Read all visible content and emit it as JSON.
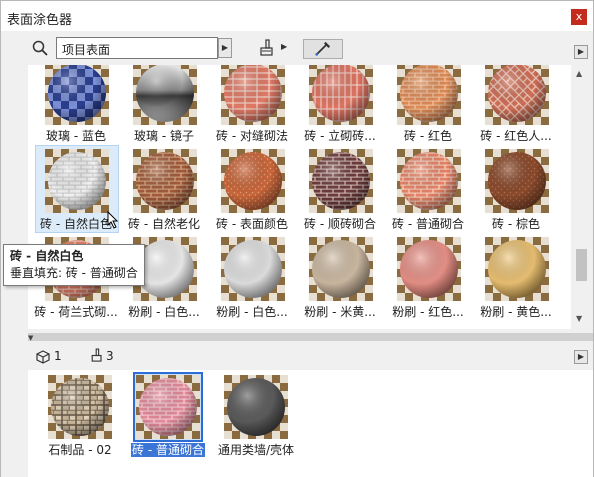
{
  "window": {
    "title": "表面涂色器",
    "close_glyph": "x"
  },
  "toolbar": {
    "search_value": "项目表面",
    "search_icon": "search-icon",
    "brush_icon": "paint-brush-icon",
    "picker_icon": "eyedropper-icon"
  },
  "materials": [
    {
      "label": "玻璃 - 蓝色",
      "pattern": "checker-blue"
    },
    {
      "label": "玻璃 - 镜子",
      "pattern": "chrome"
    },
    {
      "label": "砖 - 对缝砌法",
      "pattern": "brick-stack",
      "base": "#e07a66",
      "mortar": "#f4d6cc"
    },
    {
      "label": "砖 - 立砌砖...",
      "pattern": "brick-soldier",
      "base": "#de7463",
      "mortar": "#f2cfc5"
    },
    {
      "label": "砖 - 红色",
      "pattern": "brick-running",
      "base": "#e08a55",
      "mortar": "#f3c9a8"
    },
    {
      "label": "砖 - 红色人...",
      "pattern": "brick-herring",
      "base": "#cf6e56",
      "mortar": "#f0cdbf"
    },
    {
      "label": "砖 - 自然白色",
      "pattern": "brick-running",
      "base": "#f2f2f2",
      "mortar": "#c9c9c9",
      "selected": true
    },
    {
      "label": "砖 - 自然老化",
      "pattern": "brick-running",
      "base": "#a35a3a",
      "mortar": "#d8b08c"
    },
    {
      "label": "砖 - 表面颜色",
      "pattern": "speckle",
      "base": "#c9663b",
      "mortar": "#e6a274"
    },
    {
      "label": "砖 - 顺砖砌合",
      "pattern": "brick-running",
      "base": "#6e3b3b",
      "mortar": "#d8c4c0"
    },
    {
      "label": "砖 - 普通砌合",
      "pattern": "brick-running",
      "base": "#e88366",
      "mortar": "#f8d8c9"
    },
    {
      "label": "砖 - 棕色",
      "pattern": "speckle",
      "base": "#8a4a2c",
      "mortar": "#b27252"
    },
    {
      "label": "砖 - 荷兰式砌...",
      "pattern": "brick-running",
      "base": "#e57d66",
      "mortar": "#f6d4c7"
    },
    {
      "label": "粉刷 - 白色...",
      "pattern": "plain",
      "base": "#f4f4f4",
      "mortar": "#d8d8d8"
    },
    {
      "label": "粉刷 - 白色...",
      "pattern": "plain",
      "base": "#ececec",
      "mortar": "#cdcdcd"
    },
    {
      "label": "粉刷 - 米黄...",
      "pattern": "plain",
      "base": "#d9c8b2",
      "mortar": "#b9a68f"
    },
    {
      "label": "粉刷 - 红色...",
      "pattern": "plain",
      "base": "#f0a39a",
      "mortar": "#d67e74"
    },
    {
      "label": "粉刷 - 黄色...",
      "pattern": "plain",
      "base": "#f2cf8a",
      "mortar": "#d9ad5c"
    }
  ],
  "tooltip": {
    "title": "砖 - 自然白色",
    "line2": "垂直填充: 砖 - 普通砌合"
  },
  "bottom": {
    "count_objects": "1",
    "count_surfaces": "3",
    "cube_icon": "cube-icon",
    "brush_icon": "paint-brush-icon",
    "items": [
      {
        "label": "石制品 - 02",
        "pattern": "stone",
        "base": "#c9b79c",
        "mortar": "#6d5c49"
      },
      {
        "label": "砖 - 普通砌合",
        "pattern": "brick-running",
        "base": "#e58a9a",
        "mortar": "#f7d3da",
        "selected": true
      },
      {
        "label": "通用类墙/壳体",
        "pattern": "plain",
        "base": "#6e6e6e",
        "mortar": "#4a4a4a"
      }
    ]
  }
}
